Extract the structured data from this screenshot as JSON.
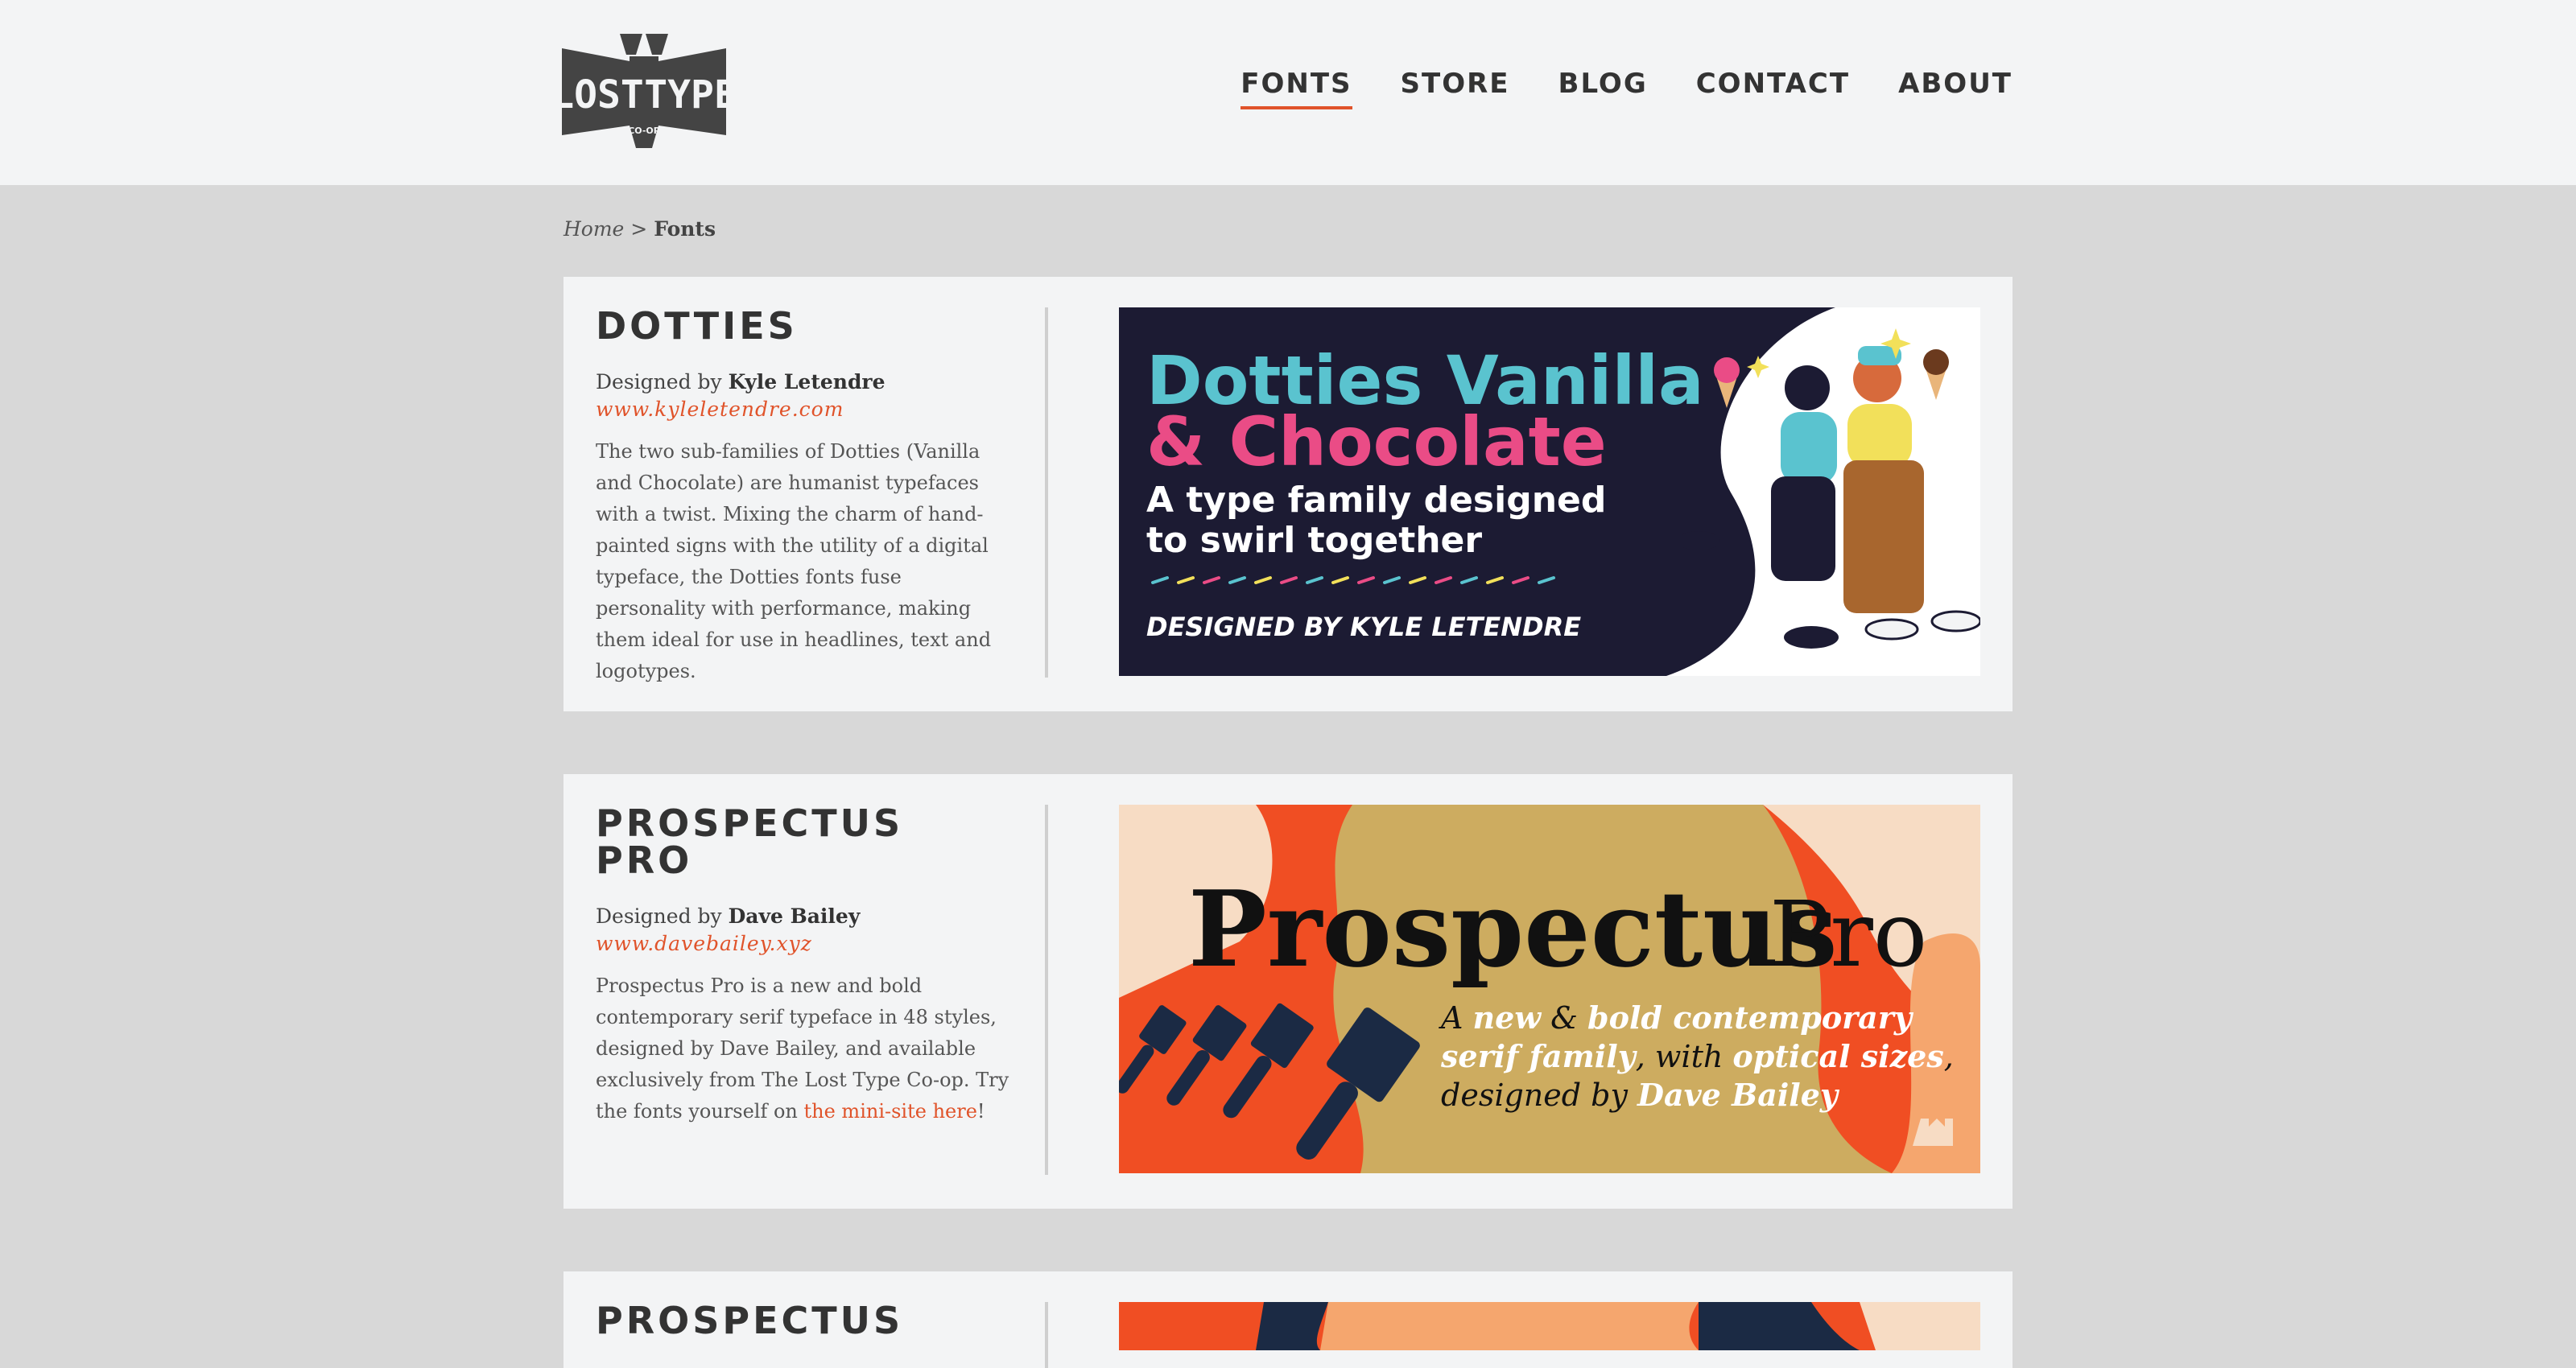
{
  "nav": {
    "items": [
      {
        "label": "FONTS",
        "active": true
      },
      {
        "label": "STORE",
        "active": false
      },
      {
        "label": "BLOG",
        "active": false
      },
      {
        "label": "CONTACT",
        "active": false
      },
      {
        "label": "ABOUT",
        "active": false
      }
    ]
  },
  "logo": {
    "line1": "LOST",
    "line2": "TYPE",
    "sub": "CO-OP"
  },
  "breadcrumb": {
    "home": "Home",
    "sep": " > ",
    "current": "Fonts"
  },
  "fonts": [
    {
      "name": "DOTTIES",
      "designed_by_prefix": "Designed by ",
      "designer": "Kyle Letendre",
      "url": "www.kyleletendre.com",
      "description": "The two sub-families of Dotties (Vanilla and Chocolate) are humanist typefaces with a twist. Mixing the charm of hand-painted signs with the utility of a digital typeface, the Dotties fonts fuse personality with performance, making them ideal for use in headlines, text and logotypes.",
      "banner": {
        "title1": "Dotties Vanilla",
        "title2": "& Chocolate",
        "tag1": "A type family designed",
        "tag2": "to swirl together",
        "credit": "DESIGNED BY KYLE LETENDRE"
      }
    },
    {
      "name": "PROSPECTUS PRO",
      "designed_by_prefix": "Designed by ",
      "designer": "Dave Bailey",
      "url": "www.davebailey.xyz",
      "description_pre": "Prospectus Pro is a new and bold contemporary serif typeface in 48 styles, designed by Dave Bailey, and available exclusively from The Lost Type Co-op. Try the fonts yourself on ",
      "description_link": "the mini-site here",
      "description_post": "!",
      "banner": {
        "title_bold": "Prospectus",
        "title_light": "Pro",
        "line1_a": "A ",
        "line1_b": "new",
        "line1_c": " & ",
        "line1_d": "bold contemporary",
        "line2_a": "serif family",
        "line2_b": ", with ",
        "line2_c": "optical sizes",
        "line2_d": ",",
        "line3_a": "designed by ",
        "line3_b": "Dave Bailey"
      }
    },
    {
      "name": "PROSPECTUS"
    }
  ],
  "colors": {
    "accent": "#e0532a",
    "page_bg": "#d8d8d8",
    "card_bg": "#f3f4f5",
    "dotties_bg": "#1c1b33",
    "dotties_cyan": "#5ac3cf",
    "dotties_pink": "#ea4c86",
    "prospectus_orange": "#f04e23",
    "prospectus_gold": "#cdac60",
    "prospectus_peach": "#f5a66e",
    "prospectus_cream": "#f7dcc4"
  }
}
